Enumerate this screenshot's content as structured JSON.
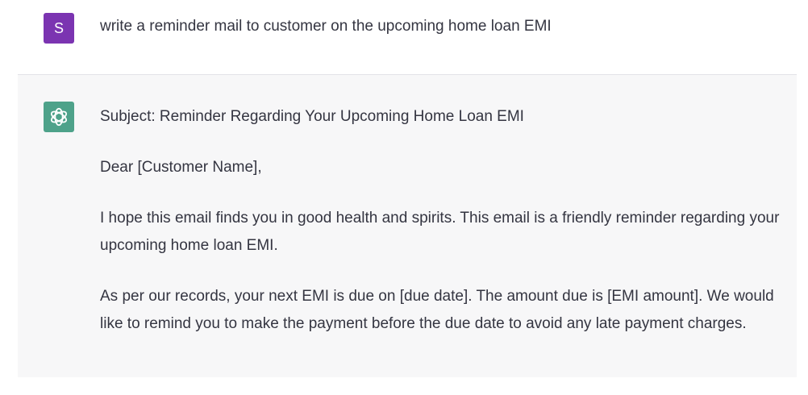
{
  "user_message": {
    "avatar_letter": "S",
    "text": "write a reminder mail to customer on the upcoming home loan EMI"
  },
  "assistant_message": {
    "avatar_icon": "openai-logo-icon",
    "paragraphs": [
      "Subject: Reminder Regarding Your Upcoming Home Loan EMI",
      "Dear [Customer Name],",
      "I hope this email finds you in good health and spirits. This email is a friendly reminder regarding your upcoming home loan EMI.",
      "As per our records, your next EMI is due on [due date]. The amount due is [EMI amount]. We would like to remind you to make the payment before the due date to avoid any late payment charges."
    ]
  },
  "colors": {
    "user_avatar": "#7b34b1",
    "assistant_avatar": "#4ea28a",
    "assistant_background": "#f7f7f8",
    "text": "#343541"
  }
}
